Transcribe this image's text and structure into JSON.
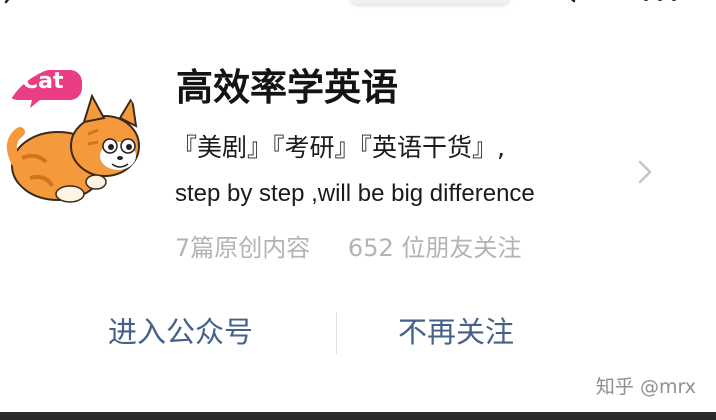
{
  "account": {
    "name": "高效率学英语",
    "tags_line": "『美剧』『考研』『英语干货』,",
    "description": "step by step ,will be big difference",
    "original_count": "7篇原创内容",
    "followers": "652 位朋友关注",
    "avatar_label": "Cat"
  },
  "actions": {
    "enter_label": "进入公众号",
    "unfollow_label": "不再关注"
  },
  "watermark": "知乎 @mrx",
  "colors": {
    "link": "#45618a",
    "muted": "#b3b3b3",
    "cat_orange": "#f49a3c",
    "badge_pink": "#ea3d86"
  },
  "icons": {
    "back": "chevron-left-icon",
    "search": "search-icon",
    "more": "more-icon",
    "arrow": "chevron-right-icon"
  }
}
